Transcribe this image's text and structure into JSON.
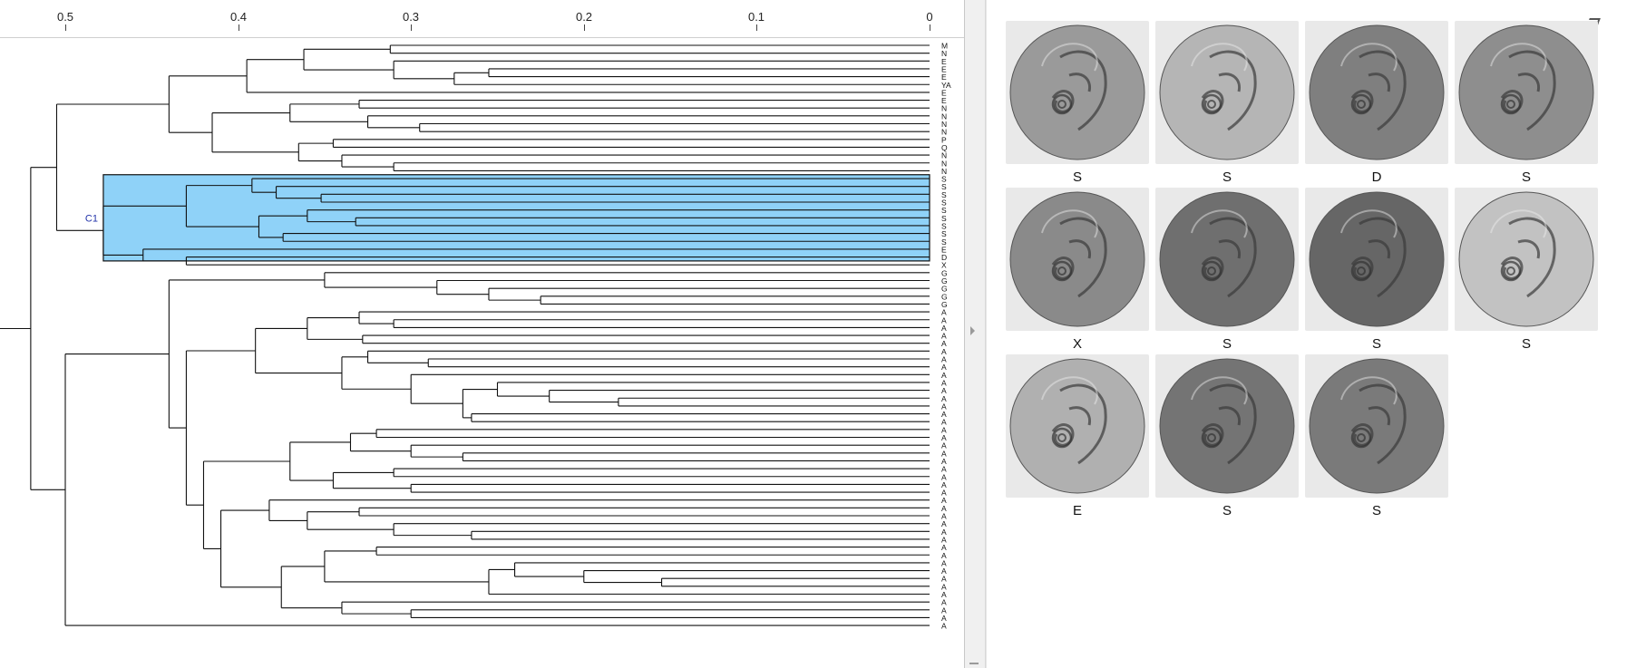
{
  "axis": {
    "ticks": [
      "0.5",
      "0.4",
      "0.3",
      "0.2",
      "0.1",
      "0"
    ],
    "tick_values": [
      0.5,
      0.4,
      0.3,
      0.2,
      0.1,
      0
    ]
  },
  "tree": {
    "cluster_label": "C1",
    "highlight_color": "#8fd2f8",
    "leaves": [
      "M",
      "N",
      "E",
      "E",
      "E",
      "YA",
      "E",
      "E",
      "N",
      "N",
      "N",
      "N",
      "P",
      "Q",
      "N",
      "N",
      "N",
      "S",
      "S",
      "S",
      "S",
      "S",
      "S",
      "S",
      "S",
      "S",
      "E",
      "D",
      "X",
      "G",
      "G",
      "G",
      "G",
      "G",
      "A",
      "A",
      "A",
      "A",
      "A",
      "A",
      "A",
      "A",
      "A",
      "A",
      "A",
      "A",
      "A",
      "A",
      "A",
      "A",
      "A",
      "A",
      "A",
      "A",
      "A",
      "A",
      "A",
      "A",
      "A",
      "A",
      "A",
      "A",
      "A",
      "A",
      "A",
      "A",
      "A",
      "A",
      "A",
      "A",
      "A",
      "A",
      "A",
      "A",
      "A"
    ]
  },
  "gallery": {
    "items": [
      {
        "label": "S",
        "tone": "#9a9a9a"
      },
      {
        "label": "S",
        "tone": "#b5b5b5"
      },
      {
        "label": "D",
        "tone": "#7f7f7f"
      },
      {
        "label": "S",
        "tone": "#8e8e8e"
      },
      {
        "label": "X",
        "tone": "#8a8a8a"
      },
      {
        "label": "S",
        "tone": "#6f6f6f"
      },
      {
        "label": "S",
        "tone": "#666666"
      },
      {
        "label": "S",
        "tone": "#c2c2c2"
      },
      {
        "label": "E",
        "tone": "#b0b0b0"
      },
      {
        "label": "S",
        "tone": "#747474"
      },
      {
        "label": "S",
        "tone": "#7a7a7a"
      }
    ]
  }
}
